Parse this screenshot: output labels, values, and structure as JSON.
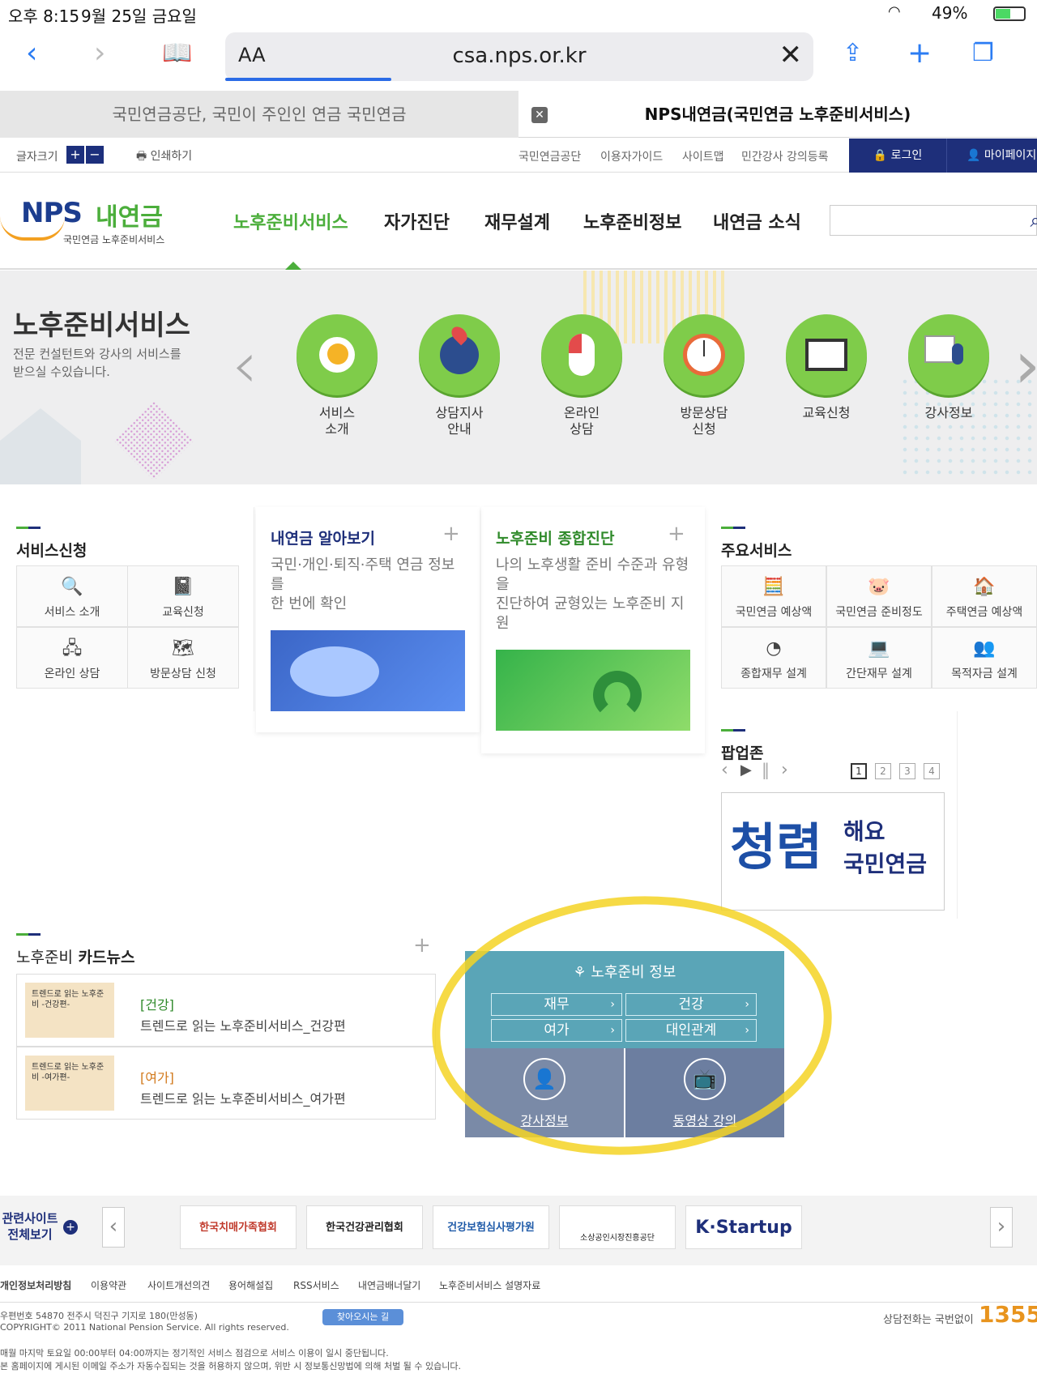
{
  "status": {
    "time": "오후 8:15",
    "date": "9월 25일 금요일",
    "battery": "49%"
  },
  "browser": {
    "aa": "AA",
    "url": "csa.nps.or.kr",
    "clear": "✕",
    "tab1": "국민연금공단, 국민이 주인인 연금 국민연금",
    "tab2": "NPS내연금(국민연금 노후준비서비스)",
    "tab_close": "✕"
  },
  "util": {
    "font_size": "글자크기",
    "plus": "+",
    "minus": "−",
    "print": "인쇄하기",
    "links": [
      "국민연금공단",
      "이용자가이드",
      "사이트맵",
      "민간강사 강의등록"
    ],
    "login": "로그인",
    "mypage": "마이페이지"
  },
  "logo": {
    "nps": "NPS",
    "nae": "내연금",
    "sub": "국민연금 노후준비서비스"
  },
  "gnb": {
    "menus": [
      "노후준비서비스",
      "자가진단",
      "재무설계",
      "노후준비정보",
      "내연금 소식"
    ],
    "active_color": "#4bae3b"
  },
  "hero": {
    "title": "노후준비서비스",
    "desc": "전문 컨설턴트와 강사의 서비스를 받으실 수있습니다.",
    "services": [
      {
        "label1": "서비스",
        "label2": "소개",
        "icon": "egg-icon"
      },
      {
        "label1": "상담지사",
        "label2": "안내",
        "icon": "globe-pin-icon"
      },
      {
        "label1": "온라인",
        "label2": "상담",
        "icon": "mouse-icon"
      },
      {
        "label1": "방문상담",
        "label2": "신청",
        "icon": "clock-icon"
      },
      {
        "label1": "교육신청",
        "label2": "",
        "icon": "book-icon"
      },
      {
        "label1": "강사정보",
        "label2": "",
        "icon": "mic-icon"
      }
    ]
  },
  "service_apply": {
    "title": "서비스신청",
    "items": [
      "서비스 소개",
      "교육신청",
      "온라인 상담",
      "방문상담 신청"
    ]
  },
  "my_pension": {
    "title": "내연금 알아보기",
    "plus": "+",
    "line1": "국민·개인·퇴직·주택 연금 정보를",
    "line2": "한 번에 확인"
  },
  "diagnosis": {
    "title": "노후준비 종합진단",
    "plus": "+",
    "line1": "나의 노후생활 준비 수준과 유형을",
    "line2": "진단하여 균형있는 노후준비 지원"
  },
  "main_services": {
    "title": "주요서비스",
    "items": [
      "국민연금 예상액",
      "국민연금 준비정도",
      "주택연금 예상액",
      "종합재무 설계",
      "간단재무 설계",
      "목적자금 설계"
    ]
  },
  "popup": {
    "title": "팝업존",
    "pages": [
      "1",
      "2",
      "3",
      "4"
    ],
    "banner_big": "청렴",
    "banner_small1": "해요",
    "banner_small2": "국민연금"
  },
  "card_news": {
    "title_a": "노후준비",
    "title_b": "카드뉴스",
    "plus": "+",
    "items": [
      {
        "tag": "[건강]",
        "text": "트렌드로 읽는 노후준비서비스_건강편",
        "thumb": "트렌드로 읽는 노후준비 -건강편-"
      },
      {
        "tag": "[여가]",
        "text": "트렌드로 읽는 노후준비서비스_여가편",
        "thumb": "트렌드로 읽는 노후준비 -여가편-"
      }
    ]
  },
  "info_box": {
    "title": "노후준비 정보",
    "buttons": [
      "재무",
      "건강",
      "여가",
      "대인관계"
    ],
    "arrow": "›",
    "instructor": "강사정보",
    "video": "동영상 강의"
  },
  "related": {
    "label1": "관련사이트",
    "label2": "전체보기",
    "banners": [
      "한국치매가족협회",
      "한국건강관리협회",
      "건강보험심사평가원",
      "소상공인시장진흥공단",
      "K·Startup"
    ]
  },
  "footer": {
    "links": [
      "개인정보처리방침",
      "이용약관",
      "사이트개선의견",
      "용어해설집",
      "RSS서비스",
      "내연금배너달기",
      "노후준비서비스 설명자료"
    ],
    "address": "우편번호 54870 전주시 덕진구 기지로 180(만성동)",
    "copyright": "COPYRIGHT© 2011 National Pension Service. All rights reserved.",
    "find_btn": "찾아오시는 길",
    "notice1": "매월 마지막 토요일 00:00부터 04:00까지는 정기적인 서비스 점검으로 서비스 이용이 일시 중단됩니다.",
    "notice2": "본 홈페이지에 게시된 이메일 주소가 자동수집되는 것을 허용하지 않으며, 위반 시 정보통신망법에 의해 처벌 될 수 있습니다.",
    "call_label": "상담전화는 국번없이",
    "call_number": "1355"
  }
}
